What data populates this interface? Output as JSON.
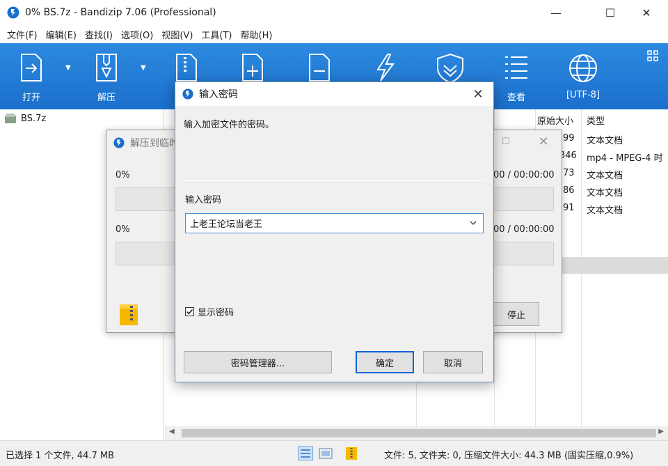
{
  "window": {
    "title": "0% BS.7z - Bandizip 7.06 (Professional)"
  },
  "menu": [
    "文件(F)",
    "编辑(E)",
    "查找(I)",
    "选项(O)",
    "视图(V)",
    "工具(T)",
    "帮助(H)"
  ],
  "toolbar": {
    "open_label": "打开",
    "extract_label": "解压",
    "view_label": "查看",
    "encoding_label": "[UTF-8]"
  },
  "tree": {
    "root_label": "BS.7z"
  },
  "filelist": {
    "col_size": "原始大小",
    "col_type": "类型",
    "rows": [
      {
        "size": "99",
        "type": "文本文档"
      },
      {
        "size": "346",
        "type": "mp4 - MPEG-4 时"
      },
      {
        "size": "73",
        "type": "文本文档"
      },
      {
        "size": "86",
        "type": "文本文档"
      },
      {
        "size": "91",
        "type": "文本文档"
      }
    ]
  },
  "progress_dialog": {
    "title": "解压到临时",
    "pct1": "0%",
    "pct2": "0%",
    "time1": "00 / 00:00:00",
    "time2": "00 / 00:00:00",
    "stop_label": "停止"
  },
  "password_dialog": {
    "title": "输入密码",
    "description": "输入加密文件的密码。",
    "input_label": "输入密码",
    "input_value": "上老王论坛当老王",
    "show_password_label": "显示密码",
    "show_password_checked": true,
    "manager_button": "密码管理器...",
    "ok_button": "确定",
    "cancel_button": "取消"
  },
  "statusbar": {
    "left": "已选择 1 个文件, 44.7 MB",
    "right": "文件: 5, 文件夹: 0, 压缩文件大小: 44.3 MB (固实压缩,0.9%)"
  },
  "colors": {
    "toolbar": "#1f7ad6",
    "accent": "#0a64d6"
  }
}
